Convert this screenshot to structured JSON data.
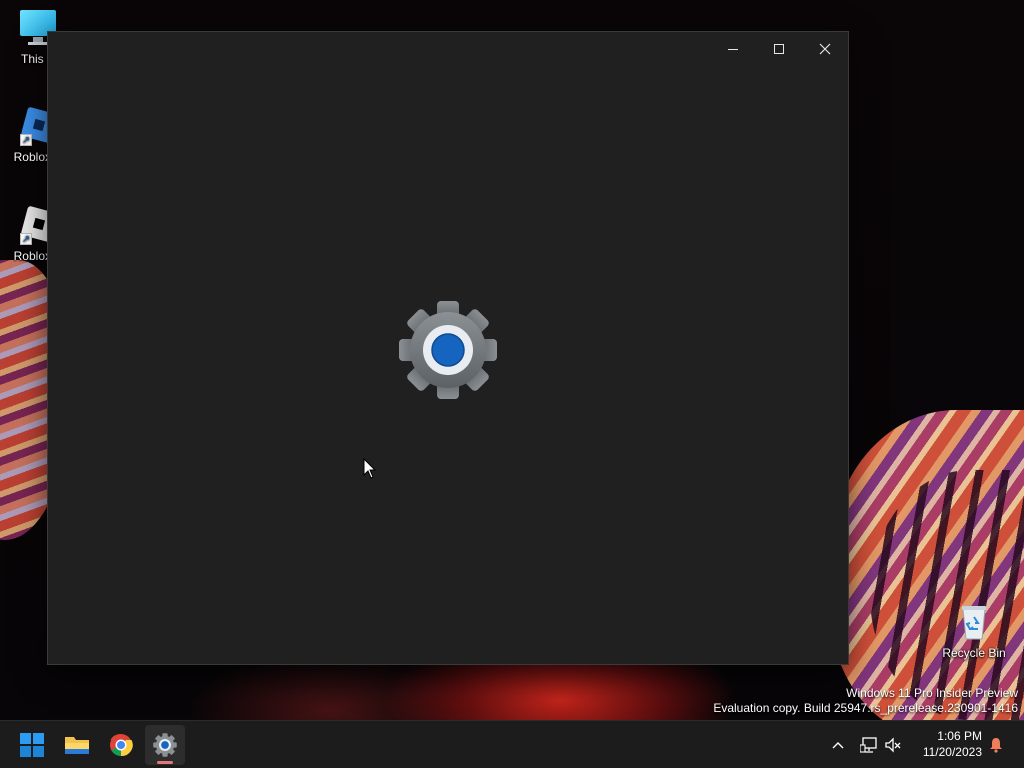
{
  "desktop": {
    "icons": [
      {
        "label": "This P",
        "icon": "this-pc-icon"
      },
      {
        "label": "Roblox S",
        "icon": "roblox-studio-icon"
      },
      {
        "label": "Roblox P",
        "icon": "roblox-player-icon"
      },
      {
        "label": "Recycle Bin",
        "icon": "recycle-bin-icon"
      }
    ],
    "watermark": {
      "line1": "Windows 11 Pro Insider Preview",
      "line2": "Evaluation copy. Build 25947.rs_prerelease.230901-1416"
    }
  },
  "window": {
    "app": "Settings",
    "state": "loading splash",
    "controls": [
      "minimize",
      "maximize",
      "close"
    ],
    "splash_icon": "settings-gear-icon",
    "colors": {
      "background": "#202020",
      "gear_outer": "#6f7478",
      "gear_ring": "#ffffff",
      "gear_center": "#1565c0"
    }
  },
  "taskbar": {
    "apps": [
      {
        "name": "Start",
        "icon": "windows-logo-icon",
        "active": false
      },
      {
        "name": "File Explorer",
        "icon": "folder-icon",
        "active": false
      },
      {
        "name": "Google Chrome",
        "icon": "chrome-icon",
        "active": false
      },
      {
        "name": "Settings",
        "icon": "settings-gear-icon",
        "active": true
      }
    ],
    "tray": {
      "icons": [
        "chevron-up-icon",
        "network-icon",
        "volume-muted-icon",
        "notification-bell-icon"
      ],
      "time": "1:06 PM",
      "date": "11/20/2023"
    },
    "colors": {
      "background": "#1c1c1c",
      "active_indicator": "#e07a7a"
    }
  }
}
